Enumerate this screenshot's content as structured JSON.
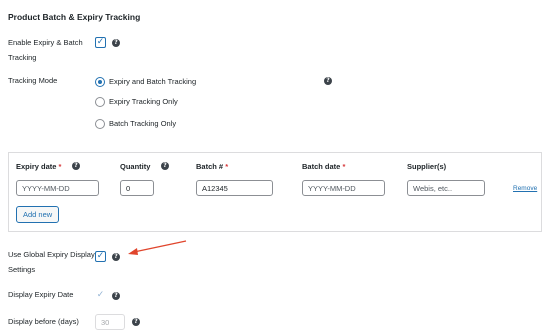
{
  "section_title": "Product Batch & Expiry Tracking",
  "enable": {
    "label_line1": "Enable Expiry & Batch",
    "label_line2": "Tracking",
    "checked_glyph": "✓",
    "help_glyph": "?"
  },
  "tracking_mode": {
    "label": "Tracking Mode",
    "help_glyph": "?",
    "options": [
      {
        "label": "Expiry and Batch Tracking",
        "selected": true
      },
      {
        "label": "Expiry Tracking Only",
        "selected": false
      },
      {
        "label": "Batch Tracking Only",
        "selected": false
      }
    ]
  },
  "batch_table": {
    "headers": {
      "expiry_date": "Expiry date",
      "quantity": "Quantity",
      "batch_no": "Batch #",
      "batch_date": "Batch date",
      "supplier": "Supplier(s)",
      "required_mark": "*",
      "help_glyph": "?"
    },
    "row": {
      "expiry_date_placeholder": "YYYY-MM-DD",
      "quantity_value": "0",
      "batch_no_value": "A12345",
      "batch_date_placeholder": "YYYY-MM-DD",
      "supplier_placeholder": "Webis, etc..",
      "remove_label": "Remove"
    },
    "add_new_label": "Add new"
  },
  "global_display": {
    "label_line1": "Use Global Expiry Display",
    "label_line2": "Settings",
    "checked_glyph": "✓",
    "help_glyph": "?"
  },
  "display_expiry_date": {
    "label": "Display Expiry Date",
    "checked_glyph": "✓",
    "help_glyph": "?"
  },
  "display_before": {
    "label": "Display before (days)",
    "value": "30",
    "help_glyph": "?"
  },
  "colors": {
    "accent": "#2271b1",
    "required": "#d63638",
    "annotation_arrow": "#e0452c"
  }
}
